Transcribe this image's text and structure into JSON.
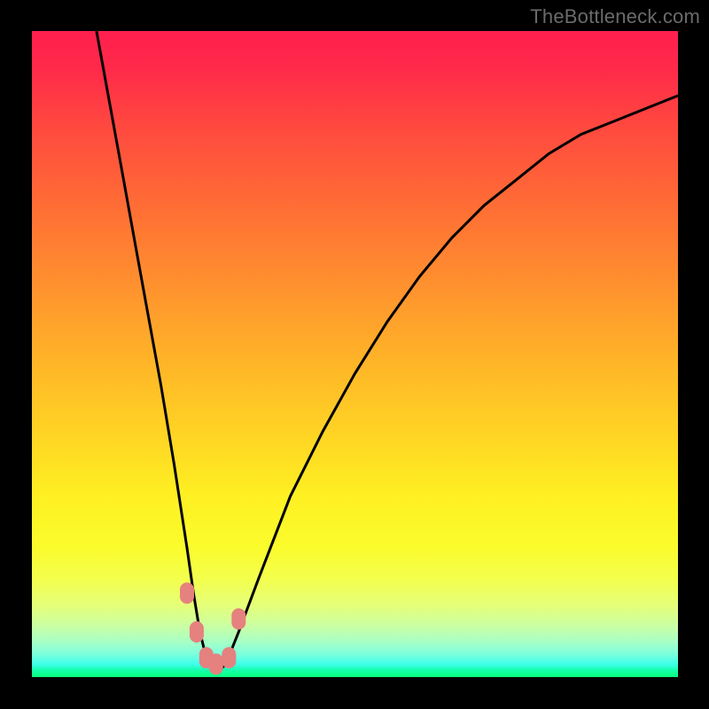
{
  "watermark": "TheBottleneck.com",
  "colors": {
    "frame": "#000000",
    "curve": "#000000",
    "markers": "#e5817e",
    "watermark": "#6b6b6b"
  },
  "chart_data": {
    "type": "line",
    "title": "",
    "xlabel": "",
    "ylabel": "",
    "xlim": [
      0,
      100
    ],
    "ylim": [
      0,
      100
    ],
    "grid": false,
    "legend": false,
    "series": [
      {
        "name": "bottleneck-curve",
        "x": [
          10,
          12,
          14,
          16,
          18,
          20,
          22,
          24,
          25,
          26,
          27,
          28,
          29,
          30,
          32,
          35,
          40,
          45,
          50,
          55,
          60,
          65,
          70,
          75,
          80,
          85,
          90,
          95,
          100
        ],
        "y": [
          100,
          89,
          78,
          67,
          56,
          45,
          33,
          20,
          13,
          7,
          3,
          1,
          1,
          2,
          7,
          15,
          28,
          38,
          47,
          55,
          62,
          68,
          73,
          77,
          81,
          84,
          86,
          88,
          90
        ]
      }
    ],
    "markers": [
      {
        "x": 24.0,
        "y": 13
      },
      {
        "x": 25.5,
        "y": 7
      },
      {
        "x": 27.0,
        "y": 3
      },
      {
        "x": 28.5,
        "y": 2
      },
      {
        "x": 30.5,
        "y": 3
      },
      {
        "x": 32.0,
        "y": 9
      }
    ],
    "background_gradient": {
      "type": "vertical",
      "stops": [
        {
          "pos": 0.0,
          "color": "#ff1f4e"
        },
        {
          "pos": 0.5,
          "color": "#ffb128"
        },
        {
          "pos": 0.8,
          "color": "#fbfc2c"
        },
        {
          "pos": 1.0,
          "color": "#0aff7e"
        }
      ]
    }
  }
}
